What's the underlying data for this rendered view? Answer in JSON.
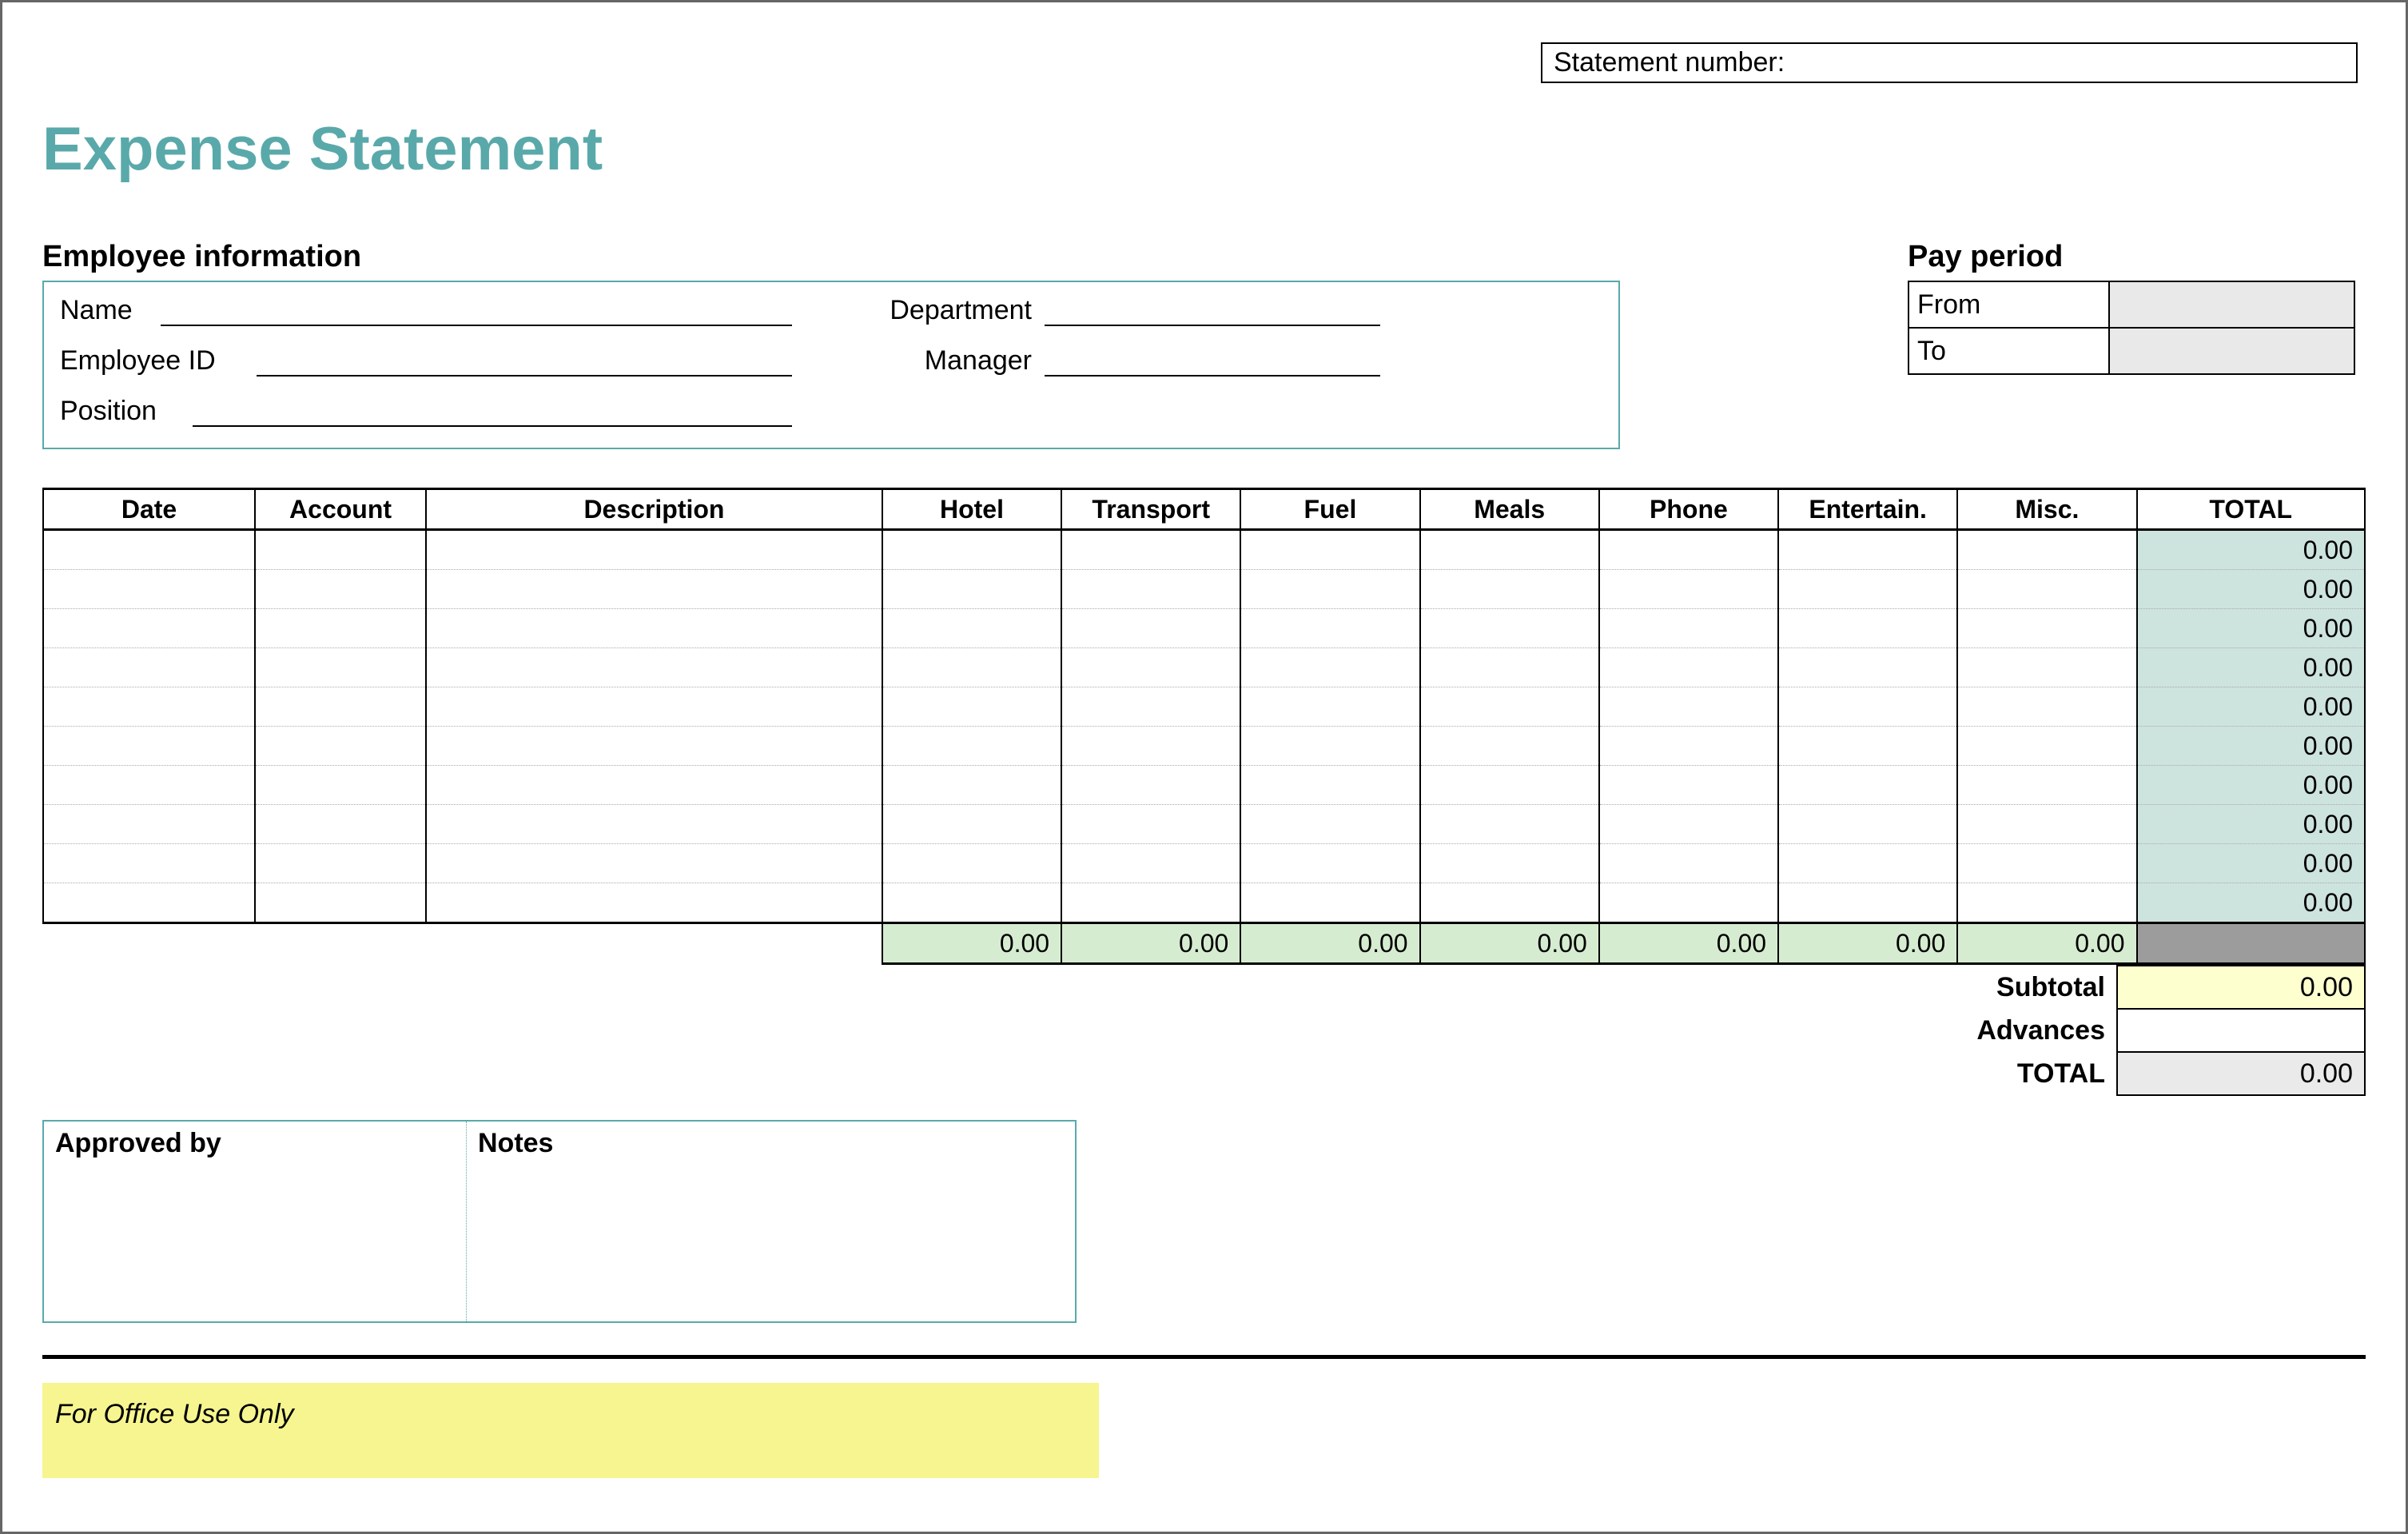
{
  "header": {
    "statement_number_label": "Statement number:",
    "statement_number_value": ""
  },
  "title": "Expense Statement",
  "employee_info": {
    "heading": "Employee information",
    "name_label": "Name",
    "name_value": "",
    "employee_id_label": "Employee ID",
    "employee_id_value": "",
    "position_label": "Position",
    "position_value": "",
    "department_label": "Department",
    "department_value": "",
    "manager_label": "Manager",
    "manager_value": ""
  },
  "pay_period": {
    "heading": "Pay period",
    "from_label": "From",
    "from_value": "",
    "to_label": "To",
    "to_value": ""
  },
  "expenses": {
    "columns": {
      "date": "Date",
      "account": "Account",
      "description": "Description",
      "hotel": "Hotel",
      "transport": "Transport",
      "fuel": "Fuel",
      "meals": "Meals",
      "phone": "Phone",
      "entertain": "Entertain.",
      "misc": "Misc.",
      "total": "TOTAL"
    },
    "rows": [
      {
        "date": "",
        "account": "",
        "description": "",
        "hotel": "",
        "transport": "",
        "fuel": "",
        "meals": "",
        "phone": "",
        "entertain": "",
        "misc": "",
        "total": "0.00"
      },
      {
        "date": "",
        "account": "",
        "description": "",
        "hotel": "",
        "transport": "",
        "fuel": "",
        "meals": "",
        "phone": "",
        "entertain": "",
        "misc": "",
        "total": "0.00"
      },
      {
        "date": "",
        "account": "",
        "description": "",
        "hotel": "",
        "transport": "",
        "fuel": "",
        "meals": "",
        "phone": "",
        "entertain": "",
        "misc": "",
        "total": "0.00"
      },
      {
        "date": "",
        "account": "",
        "description": "",
        "hotel": "",
        "transport": "",
        "fuel": "",
        "meals": "",
        "phone": "",
        "entertain": "",
        "misc": "",
        "total": "0.00"
      },
      {
        "date": "",
        "account": "",
        "description": "",
        "hotel": "",
        "transport": "",
        "fuel": "",
        "meals": "",
        "phone": "",
        "entertain": "",
        "misc": "",
        "total": "0.00"
      },
      {
        "date": "",
        "account": "",
        "description": "",
        "hotel": "",
        "transport": "",
        "fuel": "",
        "meals": "",
        "phone": "",
        "entertain": "",
        "misc": "",
        "total": "0.00"
      },
      {
        "date": "",
        "account": "",
        "description": "",
        "hotel": "",
        "transport": "",
        "fuel": "",
        "meals": "",
        "phone": "",
        "entertain": "",
        "misc": "",
        "total": "0.00"
      },
      {
        "date": "",
        "account": "",
        "description": "",
        "hotel": "",
        "transport": "",
        "fuel": "",
        "meals": "",
        "phone": "",
        "entertain": "",
        "misc": "",
        "total": "0.00"
      },
      {
        "date": "",
        "account": "",
        "description": "",
        "hotel": "",
        "transport": "",
        "fuel": "",
        "meals": "",
        "phone": "",
        "entertain": "",
        "misc": "",
        "total": "0.00"
      },
      {
        "date": "",
        "account": "",
        "description": "",
        "hotel": "",
        "transport": "",
        "fuel": "",
        "meals": "",
        "phone": "",
        "entertain": "",
        "misc": "",
        "total": "0.00"
      }
    ],
    "column_totals": {
      "hotel": "0.00",
      "transport": "0.00",
      "fuel": "0.00",
      "meals": "0.00",
      "phone": "0.00",
      "entertain": "0.00",
      "misc": "0.00"
    }
  },
  "summary": {
    "subtotal_label": "Subtotal",
    "subtotal_value": "0.00",
    "advances_label": "Advances",
    "advances_value": "",
    "total_label": "TOTAL",
    "total_value": "0.00"
  },
  "approval": {
    "approved_by_label": "Approved by",
    "notes_label": "Notes"
  },
  "footer": {
    "office_use_label": "For Office Use Only"
  }
}
